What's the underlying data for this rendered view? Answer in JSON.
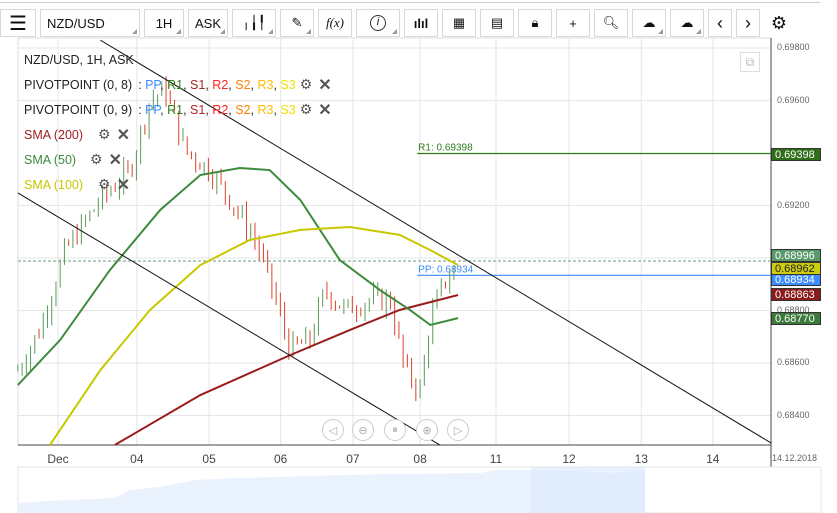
{
  "toolbar": {
    "symbol": "NZD/USD",
    "timeframe": "1H",
    "price_type": "ASK",
    "fx_label": "f(x)"
  },
  "legend": {
    "title": "NZD/USD, 1H, ASK",
    "pivots": [
      {
        "name": "PIVOTPOINT (0, 8)"
      },
      {
        "name": "PIVOTPOINT (0, 9)"
      }
    ],
    "pivot_parts": [
      {
        "t": "PP",
        "c": "#3b8cff"
      },
      {
        "t": "R1",
        "c": "#2e7d1a"
      },
      {
        "t": "S1",
        "c": "#b22222"
      },
      {
        "t": "R2",
        "c": "#ff2020"
      },
      {
        "t": "S2",
        "c": "#ff8000"
      },
      {
        "t": "R3",
        "c": "#ffbf00"
      },
      {
        "t": "S3",
        "c": "#f0e000"
      }
    ],
    "smas": [
      {
        "name": "SMA (200)",
        "color": "#9b1c1c"
      },
      {
        "name": "SMA (50)",
        "color": "#3c8a3c"
      },
      {
        "name": "SMA (100)",
        "color": "#c8c800"
      }
    ]
  },
  "chart_data": {
    "type": "line",
    "symbol": "NZD/USD",
    "interval": "1H",
    "ylim": [
      0.68262,
      0.69933
    ],
    "y_ticks": [
      "0.69800",
      "0.69600",
      "0.69200",
      "0.68800",
      "0.68600",
      "0.68400"
    ],
    "y_tick_values": [
      0.698,
      0.696,
      0.692,
      0.688,
      0.686,
      0.684
    ],
    "x_ticks": [
      {
        "label": "Dec",
        "s": 0
      },
      {
        "label": "04",
        "s": 1.08
      },
      {
        "label": "05",
        "s": 2.07
      },
      {
        "label": "06",
        "s": 3.05
      },
      {
        "label": "07",
        "s": 4.04
      },
      {
        "label": "08",
        "s": 4.96
      },
      {
        "label": "11",
        "s": 6.0
      },
      {
        "label": "12",
        "s": 7.0
      },
      {
        "label": "13",
        "s": 7.99
      },
      {
        "label": "14",
        "s": 8.97
      }
    ],
    "x_end_label": "14.12.2018",
    "price": [
      [
        -0.55,
        0.68573
      ],
      [
        -0.25,
        0.68726
      ],
      [
        0.1,
        0.6903
      ],
      [
        0.58,
        0.69221
      ],
      [
        0.99,
        0.69335
      ],
      [
        1.26,
        0.69602
      ],
      [
        1.47,
        0.6964
      ],
      [
        1.74,
        0.69411
      ],
      [
        2.08,
        0.69335
      ],
      [
        2.36,
        0.69221
      ],
      [
        2.7,
        0.69069
      ],
      [
        2.9,
        0.68916
      ],
      [
        3.18,
        0.6865
      ],
      [
        3.45,
        0.68688
      ],
      [
        3.66,
        0.68878
      ],
      [
        3.93,
        0.68802
      ],
      [
        4.27,
        0.6884
      ],
      [
        4.55,
        0.6884
      ],
      [
        4.75,
        0.68573
      ],
      [
        4.96,
        0.68497
      ],
      [
        5.1,
        0.68764
      ],
      [
        5.3,
        0.68916
      ],
      [
        5.48,
        0.68954
      ]
    ],
    "sma200": [
      [
        0.78,
        0.68288
      ],
      [
        1.95,
        0.68478
      ],
      [
        3.18,
        0.6863
      ],
      [
        4.0,
        0.68726
      ],
      [
        4.68,
        0.68802
      ],
      [
        5.48,
        0.68859
      ]
    ],
    "sma50": [
      [
        -0.55,
        0.68516
      ],
      [
        0.03,
        0.68688
      ],
      [
        0.71,
        0.68954
      ],
      [
        1.4,
        0.69183
      ],
      [
        1.95,
        0.69316
      ],
      [
        2.49,
        0.69343
      ],
      [
        2.9,
        0.69335
      ],
      [
        3.32,
        0.69221
      ],
      [
        3.86,
        0.68992
      ],
      [
        4.41,
        0.68878
      ],
      [
        4.82,
        0.68802
      ],
      [
        5.1,
        0.68745
      ],
      [
        5.48,
        0.68771
      ]
    ],
    "sma100": [
      [
        -0.11,
        0.68288
      ],
      [
        0.58,
        0.68573
      ],
      [
        1.26,
        0.68802
      ],
      [
        1.95,
        0.68973
      ],
      [
        2.63,
        0.69069
      ],
      [
        3.32,
        0.69107
      ],
      [
        4.0,
        0.69118
      ],
      [
        4.68,
        0.69088
      ],
      [
        5.1,
        0.6903
      ],
      [
        5.48,
        0.68973
      ]
    ],
    "trendlines": [
      [
        [
          0.58,
          0.6983
        ],
        [
          9.77,
          0.68295
        ]
      ],
      [
        [
          -0.55,
          0.69248
        ],
        [
          5.23,
          0.68288
        ]
      ]
    ],
    "pivot_lines": [
      {
        "label": "R1: 0.69398",
        "value": 0.69398,
        "color": "#2e7d1a",
        "from": 4.92
      },
      {
        "label": "PP: 0.68934",
        "value": 0.68934,
        "color": "#3b8cff",
        "from": 4.92
      }
    ],
    "current_price": 0.68996
  },
  "price_labels": [
    {
      "text": "0.69398",
      "value": 0.69398,
      "bg": "#2e6e1a",
      "fg": "#fff"
    },
    {
      "text": "0.68996",
      "value": 0.6901,
      "bg": "#5a9a6a",
      "fg": "#fff"
    },
    {
      "text": "0.68934",
      "value": 0.6892,
      "bg": "#3b8cff",
      "fg": "#fff"
    },
    {
      "text": "0.68962",
      "value": 0.68962,
      "bg": "#cccc10",
      "fg": "#222"
    },
    {
      "text": "0.68863",
      "value": 0.68863,
      "bg": "#8b1a1a",
      "fg": "#fff"
    },
    {
      "text": "0.68770",
      "value": 0.6877,
      "bg": "#3c7a3c",
      "fg": "#fff"
    }
  ]
}
